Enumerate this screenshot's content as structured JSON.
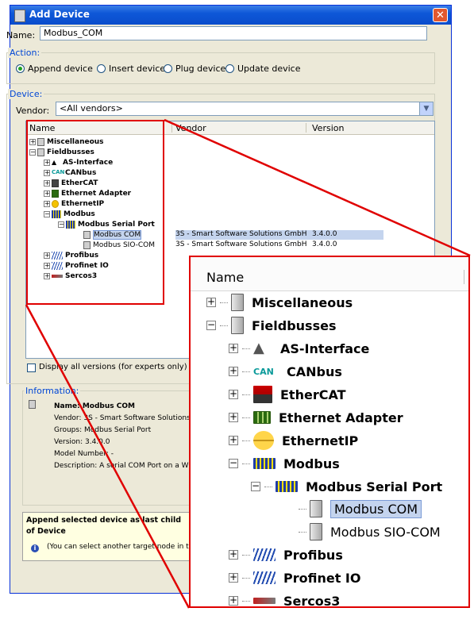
{
  "dialog": {
    "title": "Add Device",
    "close_label": "✕",
    "name_label": "Name:",
    "name_value": "Modbus_COM",
    "action_legend": "Action:",
    "actions": [
      {
        "label": "Append device",
        "selected": true
      },
      {
        "label": "Insert device",
        "selected": false
      },
      {
        "label": "Plug device",
        "selected": false
      },
      {
        "label": "Update device",
        "selected": false
      }
    ],
    "device_legend": "Device:",
    "vendor_label": "Vendor:",
    "vendor_value": "<All vendors>",
    "columns": {
      "name": "Name",
      "vendor": "Vendor",
      "version": "Version"
    },
    "tree": [
      {
        "label": "Miscellaneous",
        "expander": "+"
      },
      {
        "label": "Fieldbusses",
        "expander": "−"
      },
      {
        "label": "AS-Interface",
        "expander": "+"
      },
      {
        "label": "CANbus",
        "expander": "+",
        "icon_text": "CAN"
      },
      {
        "label": "EtherCAT",
        "expander": "+"
      },
      {
        "label": "Ethernet Adapter",
        "expander": "+"
      },
      {
        "label": "EthernetIP",
        "expander": "+"
      },
      {
        "label": "Modbus",
        "expander": "−"
      },
      {
        "label": "Modbus Serial Port",
        "expander": "−"
      },
      {
        "label": "Modbus COM",
        "vendor": "3S - Smart Software Solutions GmbH",
        "version": "3.4.0.0",
        "selected": true
      },
      {
        "label": "Modbus SIO-COM",
        "vendor": "3S - Smart Software Solutions GmbH",
        "version": "3.4.0.0"
      },
      {
        "label": "Profibus",
        "expander": "+"
      },
      {
        "label": "Profinet IO",
        "expander": "+"
      },
      {
        "label": "Sercos3",
        "expander": "+"
      }
    ],
    "experts_label": "Display all versions (for experts only)",
    "info_legend": "Information:",
    "info": {
      "name": "Name: Modbus COM",
      "vendor": "Vendor: 3S - Smart Software Solutions G",
      "groups": "Groups: Modbus Serial Port",
      "version": "Version: 3.4.0.0",
      "model": "Model Number: -",
      "description": "Description: A serial COM Port on a Win"
    },
    "hint_title": "Append selected device as last child of Device",
    "hint_text": "(You can select another target node in the",
    "hint_icon": "i"
  },
  "zoom": {
    "header": "Name"
  },
  "colors": {
    "highlight": "#e00000",
    "title_bar": "#0a4dcc",
    "dialog_bg": "#ece9d8",
    "selection": "#c4d4ee"
  }
}
